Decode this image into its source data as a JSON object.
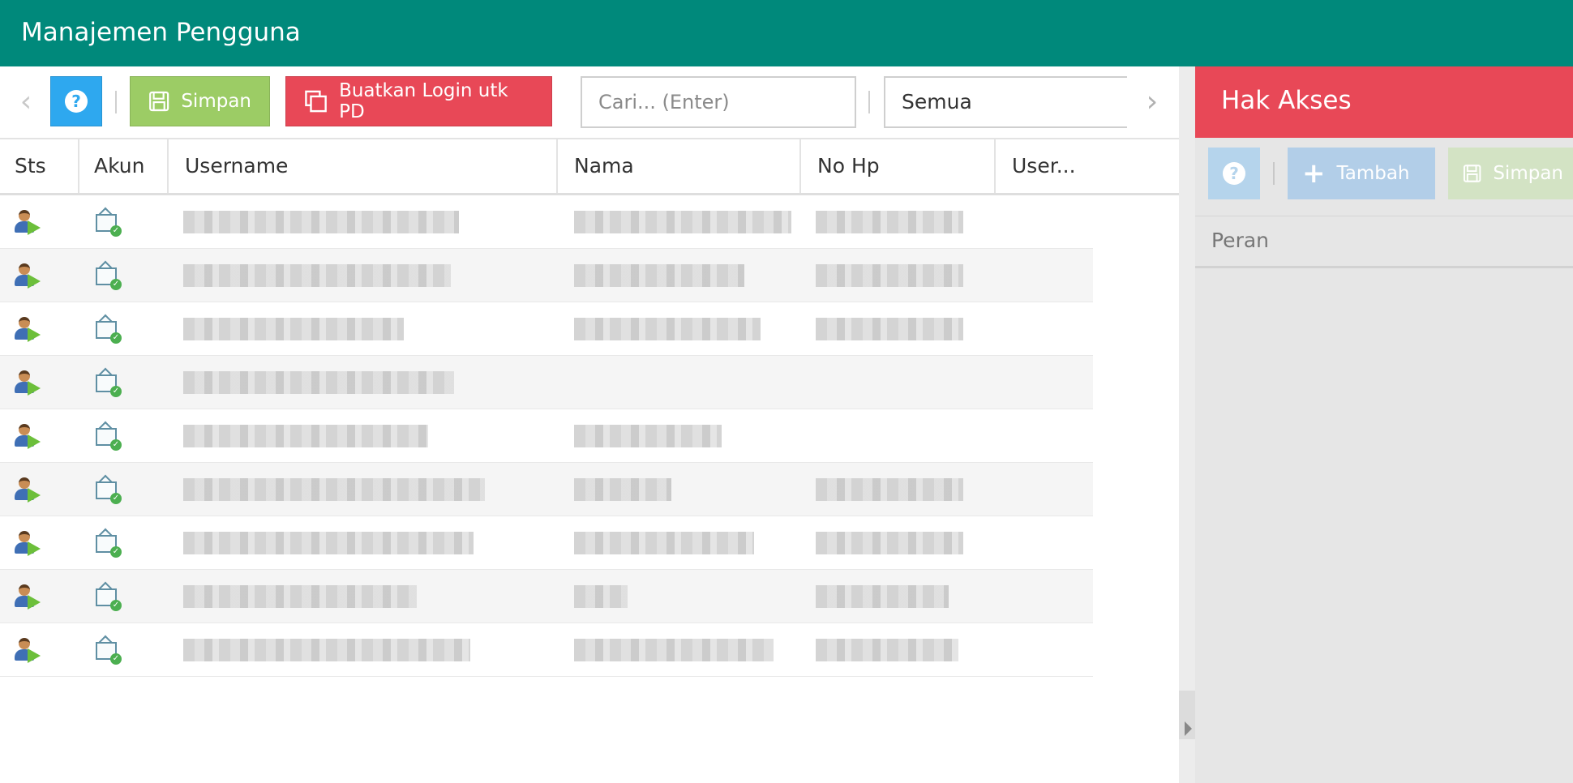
{
  "app": {
    "title": "Manajemen Pengguna"
  },
  "toolbar": {
    "help_icon": "question-circle-icon",
    "save_label": "Simpan",
    "create_login_label": "Buatkan Login utk PD",
    "search_placeholder": "Cari... (Enter)",
    "filter_selected": "Semua"
  },
  "table": {
    "columns": [
      "Sts",
      "Akun",
      "Username",
      "Nama",
      "No Hp",
      "User..."
    ],
    "rows": [
      {
        "username_w": 340,
        "nama_w": 268,
        "hp_w": 182
      },
      {
        "username_w": 330,
        "nama_w": 210,
        "hp_w": 182
      },
      {
        "username_w": 272,
        "nama_w": 230,
        "hp_w": 182
      },
      {
        "username_w": 334,
        "nama_w": 0,
        "hp_w": 0
      },
      {
        "username_w": 302,
        "nama_w": 182,
        "hp_w": 0
      },
      {
        "username_w": 372,
        "nama_w": 120,
        "hp_w": 182
      },
      {
        "username_w": 358,
        "nama_w": 222,
        "hp_w": 182
      },
      {
        "username_w": 288,
        "nama_w": 66,
        "hp_w": 164
      },
      {
        "username_w": 354,
        "nama_w": 246,
        "hp_w": 176
      }
    ]
  },
  "access_panel": {
    "title": "Hak Akses",
    "add_label": "Tambah",
    "save_label": "Simpan",
    "column": "Peran"
  },
  "colors": {
    "primary": "#00897b",
    "danger": "#e84857",
    "info": "#2ea8ef",
    "success": "#9ccc65"
  }
}
